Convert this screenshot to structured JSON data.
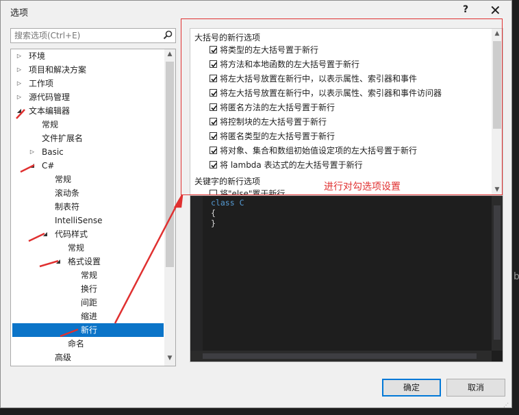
{
  "dialog": {
    "title": "选项",
    "help": "?",
    "close": "✕"
  },
  "search": {
    "placeholder": "搜索选项(Ctrl+E)"
  },
  "tree": [
    {
      "label": "环境",
      "arrow": "▷",
      "depth": 0
    },
    {
      "label": "项目和解决方案",
      "arrow": "▷",
      "depth": 0
    },
    {
      "label": "工作项",
      "arrow": "▷",
      "depth": 0
    },
    {
      "label": "源代码管理",
      "arrow": "▷",
      "depth": 0
    },
    {
      "label": "文本编辑器",
      "arrow": "◢",
      "depth": 0
    },
    {
      "label": "常规",
      "arrow": "",
      "depth": 1
    },
    {
      "label": "文件扩展名",
      "arrow": "",
      "depth": 1
    },
    {
      "label": "Basic",
      "arrow": "▷",
      "depth": 1
    },
    {
      "label": "C#",
      "arrow": "◢",
      "depth": 1
    },
    {
      "label": "常规",
      "arrow": "",
      "depth": 2
    },
    {
      "label": "滚动条",
      "arrow": "",
      "depth": 2
    },
    {
      "label": "制表符",
      "arrow": "",
      "depth": 2
    },
    {
      "label": "IntelliSense",
      "arrow": "",
      "depth": 2
    },
    {
      "label": "代码样式",
      "arrow": "◢",
      "depth": 2
    },
    {
      "label": "常规",
      "arrow": "",
      "depth": 3
    },
    {
      "label": "格式设置",
      "arrow": "◢",
      "depth": 3
    },
    {
      "label": "常规",
      "arrow": "",
      "depth": 4
    },
    {
      "label": "换行",
      "arrow": "",
      "depth": 4
    },
    {
      "label": "间距",
      "arrow": "",
      "depth": 4
    },
    {
      "label": "缩进",
      "arrow": "",
      "depth": 4
    },
    {
      "label": "新行",
      "arrow": "",
      "depth": 4,
      "selected": true
    },
    {
      "label": "命名",
      "arrow": "",
      "depth": 3
    },
    {
      "label": "高级",
      "arrow": "",
      "depth": 2
    }
  ],
  "options": {
    "group1": "大括号的新行选项",
    "items": [
      {
        "label": "将类型的左大括号置于新行",
        "checked": true
      },
      {
        "label": "将方法和本地函数的左大括号置于新行",
        "checked": true
      },
      {
        "label": "将左大括号放置在新行中，以表示属性、索引器和事件",
        "checked": true
      },
      {
        "label": "将左大括号放置在新行中，以表示属性、索引器和事件访问器",
        "checked": true
      },
      {
        "label": "将匿名方法的左大括号置于新行",
        "checked": true
      },
      {
        "label": "将控制块的左大括号置于新行",
        "checked": true
      },
      {
        "label": "将匿名类型的左大括号置于新行",
        "checked": true
      },
      {
        "label": "将对象、集合和数组初始值设定项的左大括号置于新行",
        "checked": true
      },
      {
        "label": "将 lambda 表达式的左大括号置于新行",
        "checked": true
      }
    ],
    "group2": "关键字的新行选项",
    "partial_item": "将\"else\"置于新行"
  },
  "annotation": "进行对勾选项设置",
  "preview": {
    "kw": "class",
    "name": "C",
    "open": "{",
    "close": "}"
  },
  "buttons": {
    "ok": "确定",
    "cancel": "取消"
  },
  "side_text": "b",
  "colors": {
    "selected": "#0b74c8",
    "annotation": "#e03030",
    "keyword": "#569cd6"
  }
}
